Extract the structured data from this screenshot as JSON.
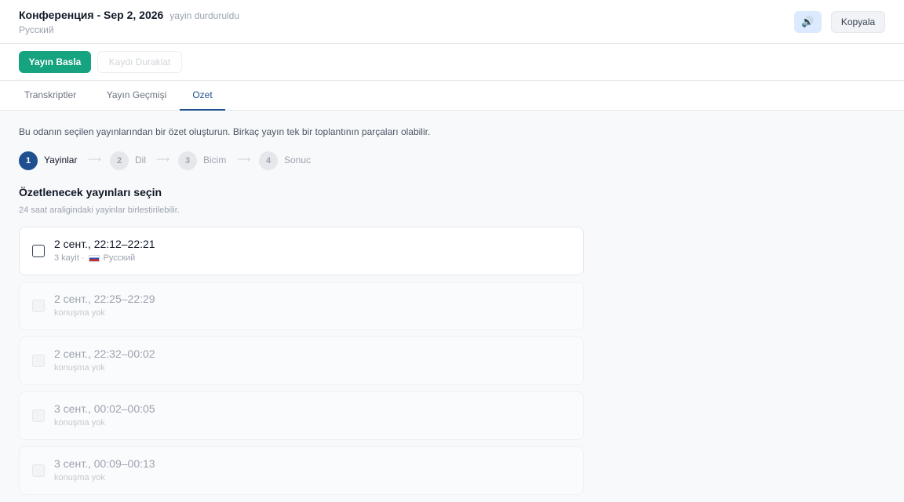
{
  "header": {
    "title": "Конференция - Sep 2, 2026",
    "status": "yayin durduruldu",
    "language": "Русский",
    "speaker_icon": "🔊",
    "copy_label": "Kopyala"
  },
  "toolbar": {
    "start_label": "Yayın Basla",
    "pause_label": "Kaydı Duraklat"
  },
  "tabs": [
    {
      "label": "Transkriptler",
      "active": false
    },
    {
      "label": "Yayın Geçmişi",
      "active": false
    },
    {
      "label": "Ozet",
      "active": true
    }
  ],
  "summary": {
    "intro": "Bu odanın seçilen yayınlarından bir özet oluşturun. Birkaç yayın tek bir toplantının parçaları olabilir.",
    "steps": [
      {
        "number": "1",
        "label": "Yayinlar",
        "active": true
      },
      {
        "number": "2",
        "label": "Dil",
        "active": false
      },
      {
        "number": "3",
        "label": "Bicim",
        "active": false
      },
      {
        "number": "4",
        "label": "Sonuc",
        "active": false
      }
    ],
    "step_arrow": "⟶",
    "section_title": "Özetlenecek yayınları seçin",
    "section_subtitle": "24 saat araligindaki yayinlar birlestirilebilir.",
    "sessions": [
      {
        "time": "2 сент., 22:12–22:21",
        "meta": "3 kayit ·",
        "lang": "Русский",
        "enabled": true
      },
      {
        "time": "2 сент., 22:25–22:29",
        "meta": "konuşma yok",
        "lang": "",
        "enabled": false
      },
      {
        "time": "2 сент., 22:32–00:02",
        "meta": "konuşma yok",
        "lang": "",
        "enabled": false
      },
      {
        "time": "3 сент., 00:02–00:05",
        "meta": "konuşma yok",
        "lang": "",
        "enabled": false
      },
      {
        "time": "3 сент., 00:09–00:13",
        "meta": "konuşma yok",
        "lang": "",
        "enabled": false
      }
    ]
  }
}
